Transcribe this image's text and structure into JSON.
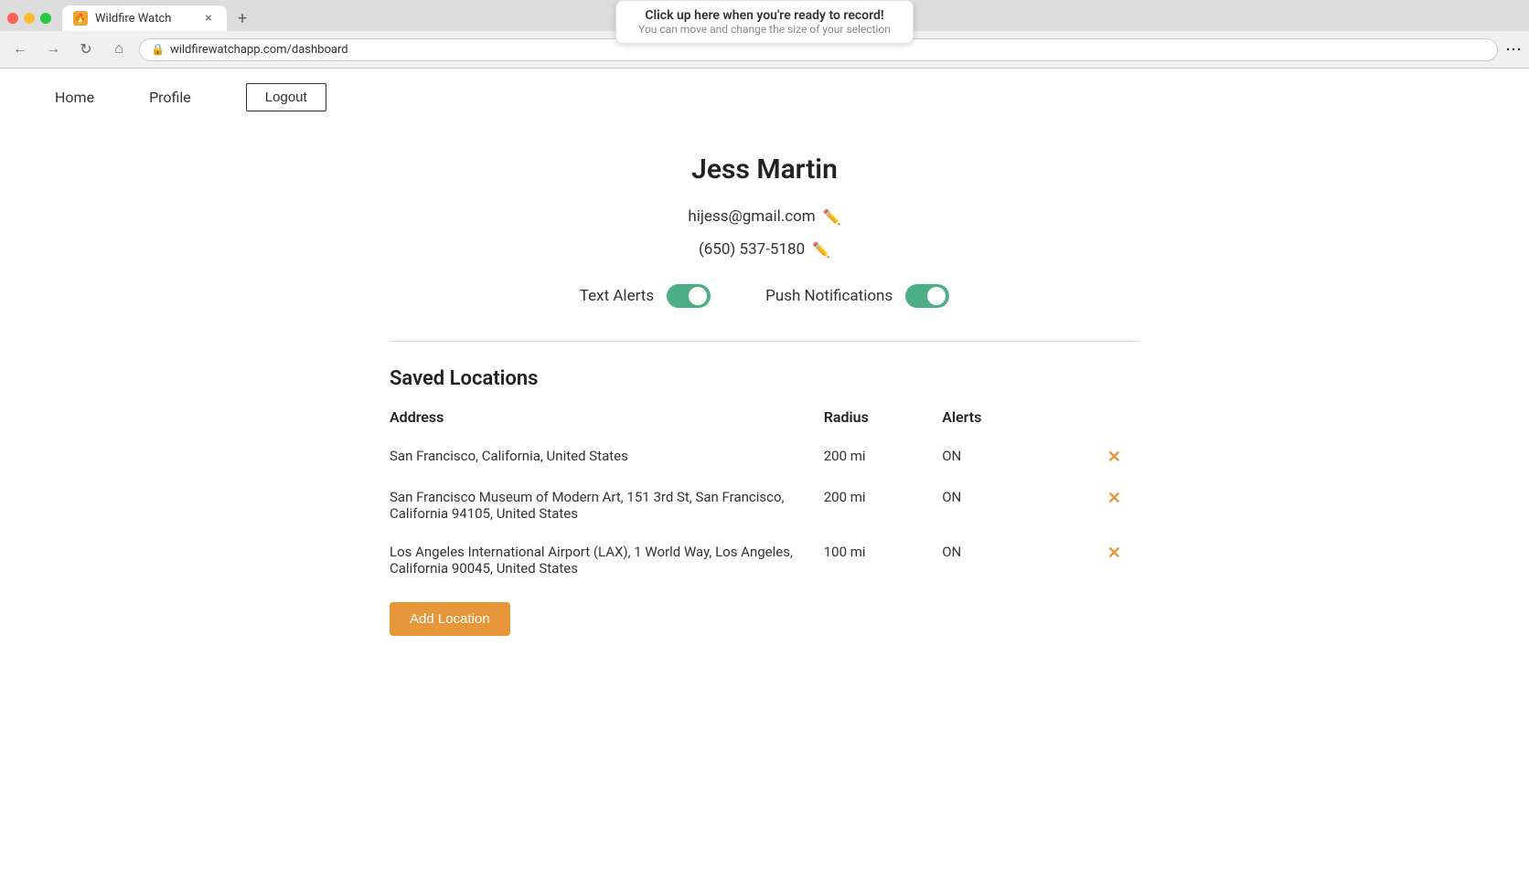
{
  "browser": {
    "tab_title": "Wildfire Watch",
    "url": "wildfirewatchapp.com/dashboard",
    "new_tab_label": "+",
    "close_label": "×"
  },
  "recording_banner": {
    "main_text": "Click up here when you're ready to record!",
    "sub_text": "You can move and change the size of your selection"
  },
  "nav": {
    "home_label": "Home",
    "profile_label": "Profile",
    "logout_label": "Logout"
  },
  "profile": {
    "name": "Jess Martin",
    "email": "hijess@gmail.com",
    "phone": "(650) 537-5180",
    "text_alerts_label": "Text Alerts",
    "push_notifications_label": "Push Notifications",
    "text_alerts_on": true,
    "push_notifications_on": true
  },
  "saved_locations": {
    "title": "Saved Locations",
    "columns": {
      "address": "Address",
      "radius": "Radius",
      "alerts": "Alerts"
    },
    "rows": [
      {
        "address": "San Francisco, California, United States",
        "radius": "200 mi",
        "alerts": "ON"
      },
      {
        "address": "San Francisco Museum of Modern Art, 151 3rd St, San Francisco, California 94105, United States",
        "radius": "200 mi",
        "alerts": "ON"
      },
      {
        "address": "Los Angeles International Airport (LAX), 1 World Way, Los Angeles, California 90045, United States",
        "radius": "100 mi",
        "alerts": "ON"
      }
    ],
    "add_location_label": "Add Location"
  }
}
